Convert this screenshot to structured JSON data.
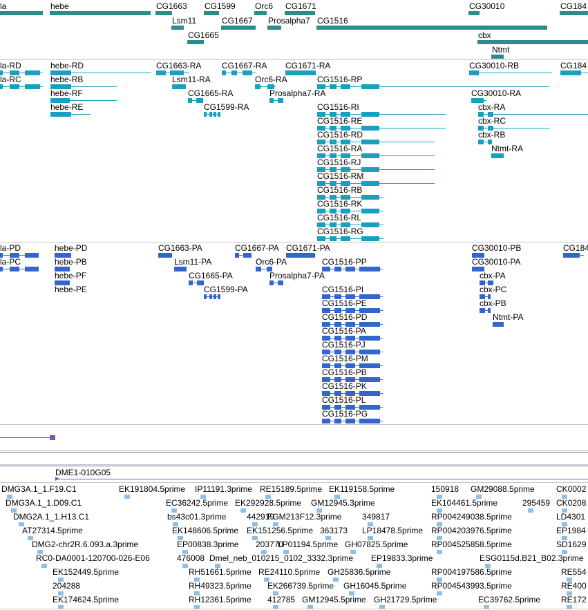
{
  "gene_track": {
    "rows": [
      [
        "la",
        "hebe",
        "CG1663",
        "CG1599",
        "Orc6",
        "CG1671",
        "CG30010",
        "CG184"
      ],
      [
        "Lsm11",
        "CG1667",
        "Prosalpha7",
        "CG1516"
      ],
      [
        "CG1665",
        "cbx"
      ],
      [
        "Ntmt"
      ]
    ]
  },
  "transcripts_rna": {
    "labels": [
      "la-RD",
      "hebe-RD",
      "CG1663-RA",
      "CG1667-RA",
      "CG1671-RA",
      "CG30010-RB",
      "CG184",
      "la-RC",
      "hebe-RB",
      "Lsm11-RA",
      "Orc6-RA",
      "CG1516-RP",
      "hebe-RF",
      "CG1665-RA",
      "Prosalpha7-RA",
      "CG30010-RA",
      "hebe-RE",
      "CG1599-RA",
      "cbx-RA",
      "CG1516-RI",
      "cbx-RC",
      "CG1516-RE",
      "cbx-RB",
      "CG1516-RD",
      "Ntmt-RA",
      "CG1516-RA",
      "CG1516-RJ",
      "CG1516-RM",
      "CG1516-RB",
      "CG1516-RK",
      "CG1516-RL",
      "CG1516-RG"
    ]
  },
  "transcripts_protein": {
    "labels": [
      "la-PD",
      "hebe-PD",
      "CG1663-PA",
      "CG1667-PA",
      "CG1671-PA",
      "CG30010-PB",
      "CG184",
      "la-PC",
      "hebe-PB",
      "Lsm11-PA",
      "Orc6-PA",
      "CG1516-PP",
      "CG30010-PA",
      "hebe-PF",
      "CG1665-PA",
      "Prosalpha7-PA",
      "cbx-PA",
      "hebe-PE",
      "CG1599-PA",
      "CG1516-PI",
      "cbx-PC",
      "CG1516-PE",
      "cbx-PB",
      "CG1516-PD",
      "Ntmt-PA",
      "CG1516-PA",
      "CG1516-PJ",
      "CG1516-PM",
      "CG1516-PB",
      "CG1516-PK",
      "CG1516-PL",
      "CG1516-PG"
    ]
  },
  "clone_track": {
    "label": "DME1-010G05"
  },
  "est_track": {
    "labels": [
      "DMG3A.1_1.F19.C1",
      "EK191804.5prime",
      "IP11191.3prime",
      "RE15189.5prime",
      "EK119158.5prime",
      "150918",
      "GM29088.5prime",
      "CK0002",
      "DMG3A.1_1.D09.C1",
      "EC36242.5prime",
      "EK292928.5prime",
      "GM12945.3prime",
      "EK104461.5prime",
      "295459",
      "CK0208",
      "DMG2A.1_1.H13.C1",
      "bs43c01.3prime",
      "442919",
      "FGM213F12.3prime",
      "349817",
      "RP004249038.5prime",
      "LD4301",
      "AT27314.5prime",
      "EK148606.5prime",
      "EK151256.5prime",
      "363173",
      "LP18478.5prime",
      "RP004203976.5prime",
      "EP1984",
      "DMG2-chr2R.6.093.a.3prime",
      "EP00838.3prime",
      "203770",
      "LP01194.5prime",
      "GH07825.5prime",
      "RP004525858.5prime",
      "SD1629",
      "RC0-DA0001-120700-026-E06",
      "476008",
      "Dmel_neb_010215_0102_3332.3prime",
      "EP19833.3prime",
      "ESG0115d.B21_B02.3prime",
      "EK152449.5prime",
      "RH51661.5prime",
      "RE24110.5prime",
      "GH25836.5prime",
      "RP004197586.5prime",
      "RE554",
      "204288",
      "RH49323.5prime",
      "EK266739.5prime",
      "GH16045.5prime",
      "RP004543993.5prime",
      "RE400",
      "EK174624.5prime",
      "RH12361.5prime",
      "412785",
      "GM12945.5prime",
      "GH21729.5prime",
      "EC39762.5prime",
      "RE172"
    ]
  },
  "colors": {
    "gene": "#2e8b8b",
    "rna": "#1a9fbf",
    "protein": "#3366cc",
    "est": "#8fbfe6",
    "clone": "#7a55a8"
  }
}
